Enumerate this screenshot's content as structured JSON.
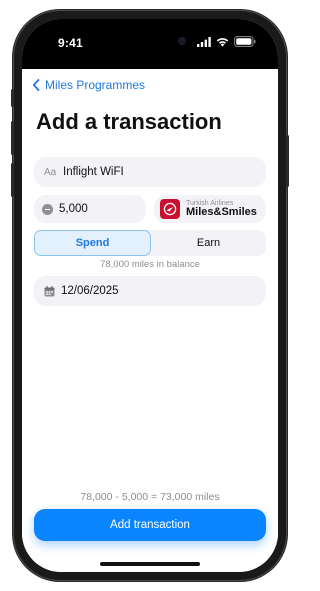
{
  "status_bar": {
    "time": "9:41",
    "icons": [
      "signal-icon",
      "wifi-icon",
      "battery-icon"
    ]
  },
  "nav": {
    "back_label": "Miles Programmes"
  },
  "page": {
    "title": "Add a transaction"
  },
  "form": {
    "description": {
      "icon": "text-format-icon",
      "icon_glyph": "Aa",
      "value": "Inflight WiFI"
    },
    "amount": {
      "icon": "minus-circle-icon",
      "value": "5,000"
    },
    "programme": {
      "airline": "Turkish Airlines",
      "name": "Miles&Smiles",
      "logo_color": "#c8102e"
    },
    "type_segment": {
      "options": [
        "Spend",
        "Earn"
      ],
      "selected": "Spend"
    },
    "balance_note": "78,000 miles in balance",
    "date": {
      "icon": "calendar-icon",
      "value": "12/06/2025"
    }
  },
  "summary": {
    "text": "78,000 - 5,000 = 73,000 miles"
  },
  "actions": {
    "add_label": "Add transaction"
  },
  "colors": {
    "accent": "#0a84ff",
    "link": "#1f7ae0",
    "field_bg": "#f2f2f7",
    "brand_red": "#c8102e"
  }
}
